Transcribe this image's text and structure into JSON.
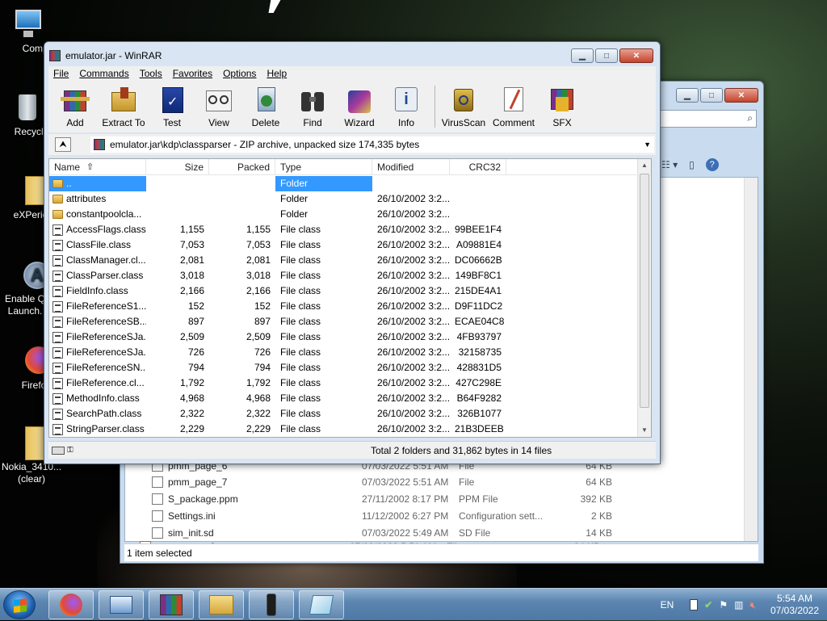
{
  "desktop": {
    "icons": [
      {
        "label": "Compu",
        "icon": "computer-icon"
      },
      {
        "label": "Recycle",
        "icon": "recycle-bin-icon"
      },
      {
        "label": "eXPerie",
        "icon": "folder-icon"
      },
      {
        "label": "Enable Q Launch.",
        "icon": "shortcut-a-icon"
      },
      {
        "label": "Firefo",
        "icon": "firefox-icon"
      },
      {
        "label": "Nokia_3410... (clear)",
        "icon": "folder-icon"
      }
    ]
  },
  "explorer": {
    "rows": [
      {
        "name": "pmm_page_6",
        "date": "07/03/2022 5:51 AM",
        "type": "File",
        "size": "64 KB"
      },
      {
        "name": "pmm_page_7",
        "date": "07/03/2022 5:51 AM",
        "type": "File",
        "size": "64 KB"
      },
      {
        "name": "S_package.ppm",
        "date": "27/11/2002 8:17 PM",
        "type": "PPM File",
        "size": "392 KB"
      },
      {
        "name": "Settings.ini",
        "date": "11/12/2002 6:27 PM",
        "type": "Configuration sett...",
        "size": "2 KB"
      },
      {
        "name": "sim_init.sd",
        "date": "07/03/2022 5:49 AM",
        "type": "SD File",
        "size": "14 KB"
      }
    ],
    "status": "1 item selected"
  },
  "winrar": {
    "title": "emulator.jar - WinRAR",
    "menu": [
      "File",
      "Commands",
      "Tools",
      "Favorites",
      "Options",
      "Help"
    ],
    "tools": [
      {
        "label": "Add",
        "icon": "add-archive-icon"
      },
      {
        "label": "Extract To",
        "icon": "extract-to-icon"
      },
      {
        "label": "Test",
        "icon": "test-icon"
      },
      {
        "label": "View",
        "icon": "view-icon"
      },
      {
        "label": "Delete",
        "icon": "delete-icon"
      },
      {
        "label": "Find",
        "icon": "find-binoculars-icon"
      },
      {
        "label": "Wizard",
        "icon": "wizard-icon"
      },
      {
        "label": "Info",
        "icon": "info-icon"
      },
      {
        "label": "VirusScan",
        "icon": "virus-scan-icon"
      },
      {
        "label": "Comment",
        "icon": "comment-icon"
      },
      {
        "label": "SFX",
        "icon": "sfx-icon"
      }
    ],
    "address": "emulator.jar\\kdp\\classparser - ZIP archive, unpacked size 174,335 bytes",
    "columns": [
      "Name",
      "Size",
      "Packed",
      "Type",
      "Modified",
      "CRC32"
    ],
    "files": [
      {
        "name": "..",
        "size": "",
        "packed": "",
        "type": "Folder",
        "modified": "",
        "crc": "",
        "kind": "folder",
        "selected": true
      },
      {
        "name": "attributes",
        "size": "",
        "packed": "",
        "type": "Folder",
        "modified": "26/10/2002 3:2...",
        "crc": "",
        "kind": "folder"
      },
      {
        "name": "constantpoolcla...",
        "size": "",
        "packed": "",
        "type": "Folder",
        "modified": "26/10/2002 3:2...",
        "crc": "",
        "kind": "folder"
      },
      {
        "name": "AccessFlags.class",
        "size": "1,155",
        "packed": "1,155",
        "type": "File class",
        "modified": "26/10/2002 3:2...",
        "crc": "99BEE1F4",
        "kind": "file"
      },
      {
        "name": "ClassFile.class",
        "size": "7,053",
        "packed": "7,053",
        "type": "File class",
        "modified": "26/10/2002 3:2...",
        "crc": "A09881E4",
        "kind": "file"
      },
      {
        "name": "ClassManager.cl...",
        "size": "2,081",
        "packed": "2,081",
        "type": "File class",
        "modified": "26/10/2002 3:2...",
        "crc": "DC06662B",
        "kind": "file"
      },
      {
        "name": "ClassParser.class",
        "size": "3,018",
        "packed": "3,018",
        "type": "File class",
        "modified": "26/10/2002 3:2...",
        "crc": "149BF8C1",
        "kind": "file"
      },
      {
        "name": "FieldInfo.class",
        "size": "2,166",
        "packed": "2,166",
        "type": "File class",
        "modified": "26/10/2002 3:2...",
        "crc": "215DE4A1",
        "kind": "file"
      },
      {
        "name": "FileReferenceS1....",
        "size": "152",
        "packed": "152",
        "type": "File class",
        "modified": "26/10/2002 3:2...",
        "crc": "D9F11DC2",
        "kind": "file"
      },
      {
        "name": "FileReferenceSB...",
        "size": "897",
        "packed": "897",
        "type": "File class",
        "modified": "26/10/2002 3:2...",
        "crc": "ECAE04C8",
        "kind": "file"
      },
      {
        "name": "FileReferenceSJa...",
        "size": "2,509",
        "packed": "2,509",
        "type": "File class",
        "modified": "26/10/2002 3:2...",
        "crc": "4FB93797",
        "kind": "file"
      },
      {
        "name": "FileReferenceSJa...",
        "size": "726",
        "packed": "726",
        "type": "File class",
        "modified": "26/10/2002 3:2...",
        "crc": "32158735",
        "kind": "file"
      },
      {
        "name": "FileReferenceSN...",
        "size": "794",
        "packed": "794",
        "type": "File class",
        "modified": "26/10/2002 3:2...",
        "crc": "428831D5",
        "kind": "file"
      },
      {
        "name": "FileReference.cl...",
        "size": "1,792",
        "packed": "1,792",
        "type": "File class",
        "modified": "26/10/2002 3:2...",
        "crc": "427C298E",
        "kind": "file"
      },
      {
        "name": "MethodInfo.class",
        "size": "4,968",
        "packed": "4,968",
        "type": "File class",
        "modified": "26/10/2002 3:2...",
        "crc": "B64F9282",
        "kind": "file"
      },
      {
        "name": "SearchPath.class",
        "size": "2,322",
        "packed": "2,322",
        "type": "File class",
        "modified": "26/10/2002 3:2...",
        "crc": "326B1077",
        "kind": "file"
      },
      {
        "name": "StringParser.class",
        "size": "2,229",
        "packed": "2,229",
        "type": "File class",
        "modified": "26/10/2002 3:2...",
        "crc": "21B3DEEB",
        "kind": "file"
      }
    ],
    "status": "Total 2 folders and 31,862 bytes in 14 files"
  },
  "taskbar": {
    "buttons": [
      "firefox-icon",
      "control-panel-icon",
      "winrar-icon",
      "explorer-icon",
      "nokia-phone-icon",
      "notepad-icon"
    ],
    "language": "EN",
    "time": "5:54 AM",
    "date": "07/03/2022"
  }
}
